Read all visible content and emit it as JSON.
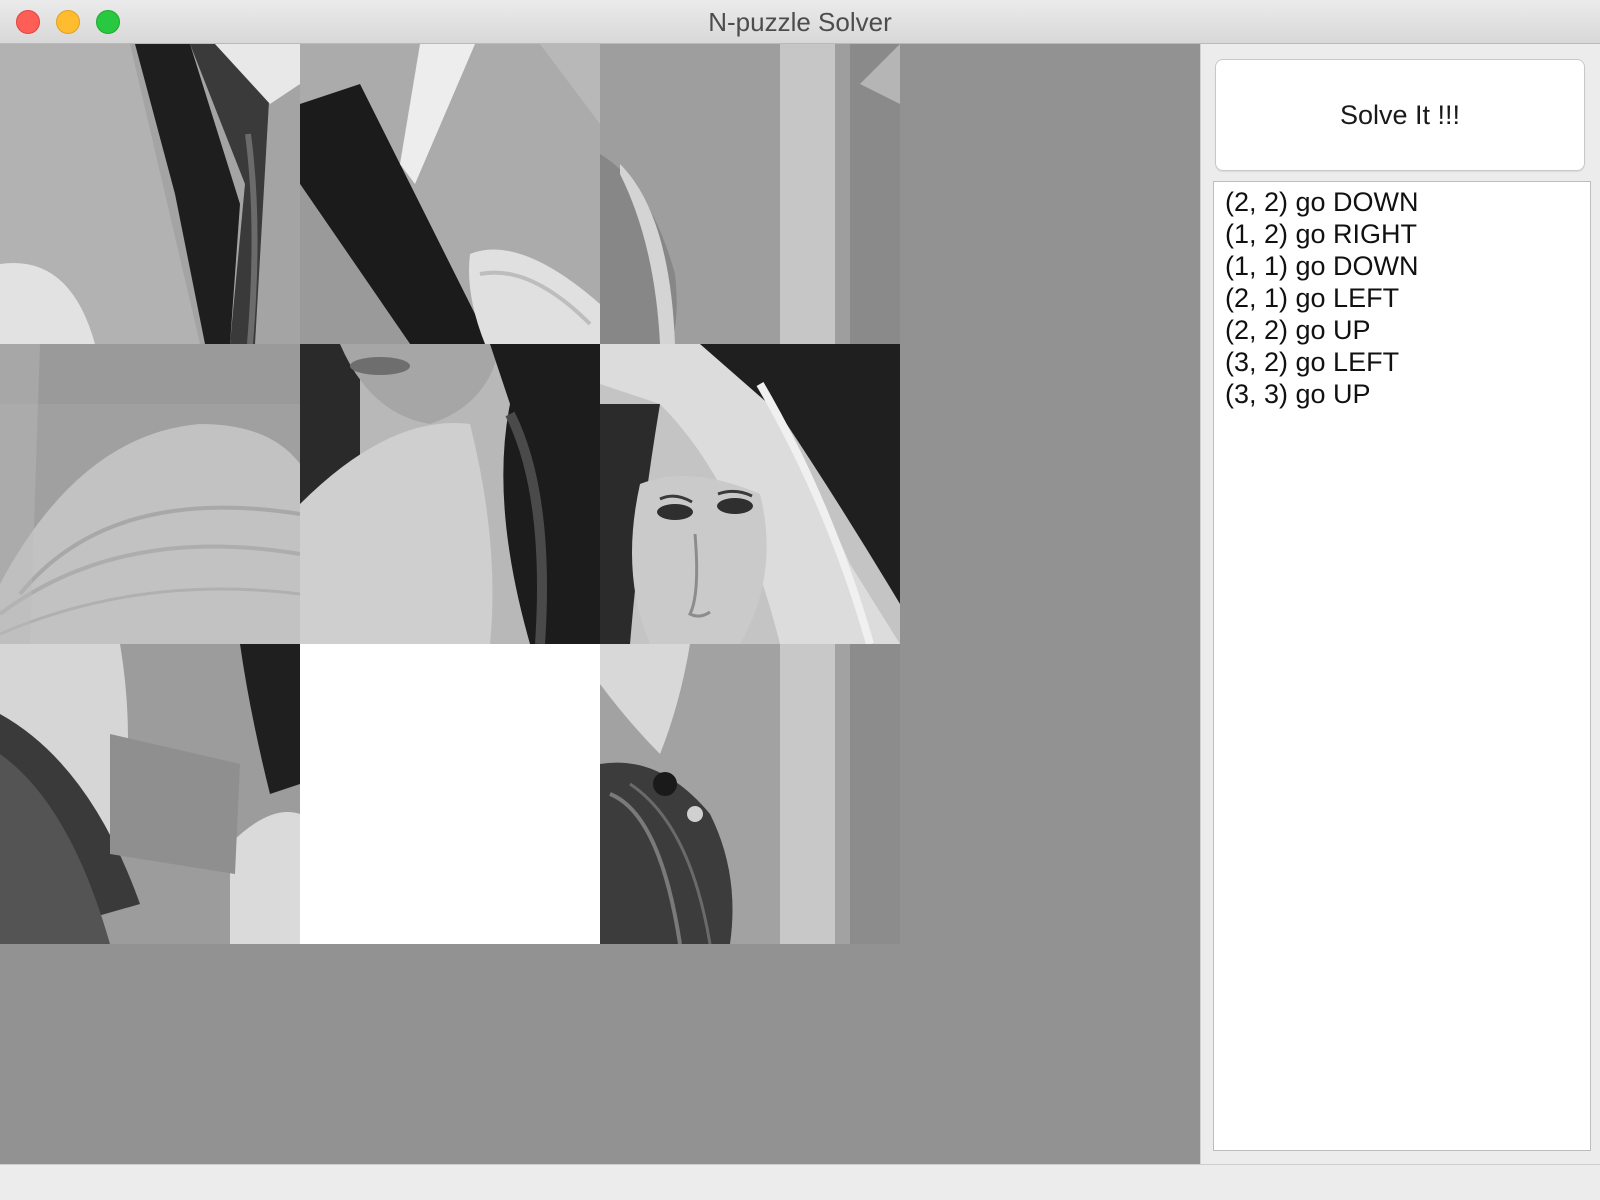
{
  "window": {
    "title": "N-puzzle Solver"
  },
  "puzzle": {
    "size": 3,
    "tiles": [
      {
        "row": 0,
        "col": 0,
        "kind": "hat-brim-hair"
      },
      {
        "row": 0,
        "col": 1,
        "kind": "hair-strand-feather"
      },
      {
        "row": 0,
        "col": 2,
        "kind": "feather-tip-background"
      },
      {
        "row": 1,
        "col": 0,
        "kind": "hat-crown"
      },
      {
        "row": 1,
        "col": 1,
        "kind": "shoulder-chin"
      },
      {
        "row": 1,
        "col": 2,
        "kind": "face-eyes"
      },
      {
        "row": 2,
        "col": 0,
        "kind": "hair-hat-brim"
      },
      {
        "row": 2,
        "col": 1,
        "kind": "empty"
      },
      {
        "row": 2,
        "col": 2,
        "kind": "feather-plume"
      }
    ],
    "colors": {
      "background": "#929292",
      "empty_tile": "#ffffff"
    }
  },
  "controls": {
    "solve_label": "Solve It !!!"
  },
  "moves": [
    "(2, 2) go DOWN",
    "(1, 2) go RIGHT",
    "(1, 1) go DOWN",
    "(2, 1) go LEFT",
    "(2, 2) go UP",
    "(3, 2) go LEFT",
    "(3, 3) go UP"
  ]
}
